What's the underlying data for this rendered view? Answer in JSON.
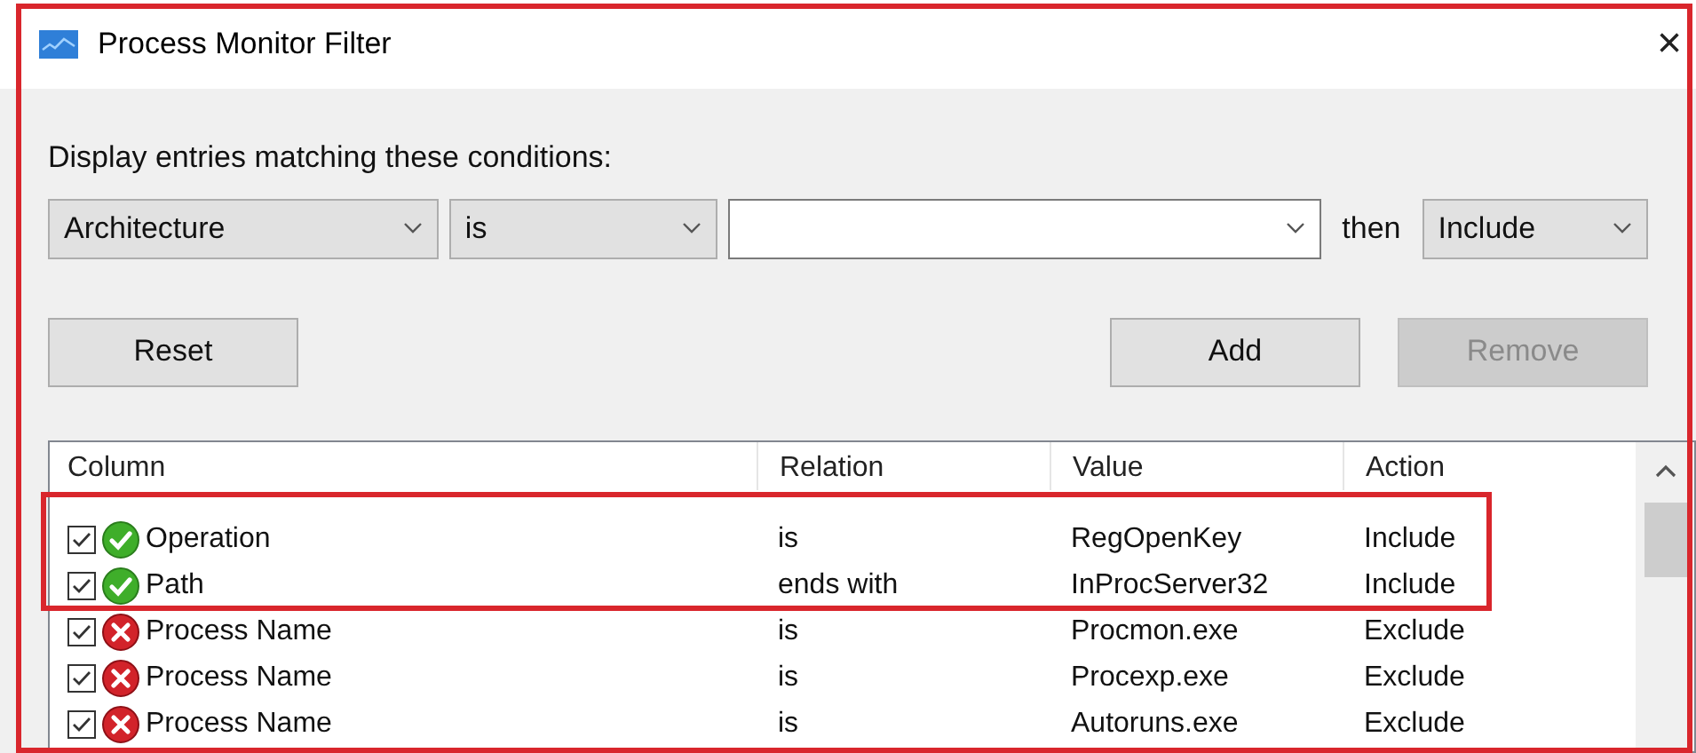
{
  "window": {
    "title": "Process Monitor Filter",
    "close": "×"
  },
  "prompt": "Display entries matching these conditions:",
  "condition": {
    "column": "Architecture",
    "relation": "is",
    "then_label": "then",
    "action": "Include"
  },
  "buttons": [
    {
      "label": "Reset",
      "disabled": false
    },
    {
      "label": "Add",
      "disabled": false
    },
    {
      "label": "Remove",
      "disabled": true
    }
  ],
  "table": {
    "columns": [
      "Column",
      "Relation",
      "Value",
      "Action"
    ],
    "rows": [
      {
        "checked": true,
        "kind": "include",
        "column": "Operation",
        "relation": "is",
        "value": "RegOpenKey",
        "action": "Include"
      },
      {
        "checked": true,
        "kind": "include",
        "column": "Path",
        "relation": "ends with",
        "value": "InProcServer32",
        "action": "Include"
      },
      {
        "checked": true,
        "kind": "exclude",
        "column": "Process Name",
        "relation": "is",
        "value": "Procmon.exe",
        "action": "Exclude"
      },
      {
        "checked": true,
        "kind": "exclude",
        "column": "Process Name",
        "relation": "is",
        "value": "Procexp.exe",
        "action": "Exclude"
      },
      {
        "checked": true,
        "kind": "exclude",
        "column": "Process Name",
        "relation": "is",
        "value": "Autoruns.exe",
        "action": "Exclude"
      }
    ]
  }
}
